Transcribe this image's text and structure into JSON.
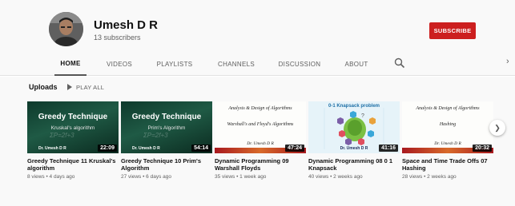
{
  "channel": {
    "name": "Umesh D R",
    "subscribers": "13 subscribers",
    "subscribe_label": "SUBSCRIBE"
  },
  "tabs": [
    {
      "label": "HOME",
      "active": true
    },
    {
      "label": "VIDEOS",
      "active": false
    },
    {
      "label": "PLAYLISTS",
      "active": false
    },
    {
      "label": "CHANNELS",
      "active": false
    },
    {
      "label": "DISCUSSION",
      "active": false
    },
    {
      "label": "ABOUT",
      "active": false
    }
  ],
  "icons": {
    "search": "search-icon",
    "next_tabs": "chevron-right-icon",
    "next_shelf": "chevron-right-icon"
  },
  "uploads": {
    "title": "Uploads",
    "play_all": "PLAY ALL"
  },
  "thumb_text": {
    "greedy_title": "Greedy Technique",
    "greedy_kruskal": "Kruskal's algorithm",
    "greedy_prim": "Prim's Algorithm",
    "greedy_author": "Dr. Umesh D R",
    "ada_heading": "Analysis & Design of Algorithms",
    "warshall_floyd": "Warshall's and Floyd's Algorithms",
    "hashing": "Hashing",
    "script_author": "Dr. Umesh D R",
    "knapsack_title": "0-1 Knapsack problem",
    "knapsack_author": "Dr. Umesh D R"
  },
  "videos": [
    {
      "title": "Greedy Technique 11 Kruskal's algorithm",
      "meta": "8 views • 4 days ago",
      "duration": "22:09"
    },
    {
      "title": "Greedy Technique 10 Prim's Algorithm",
      "meta": "27 views • 6 days ago",
      "duration": "54:14"
    },
    {
      "title": "Dynamic Programming 09 Warshall Floyds",
      "meta": "35 views • 1 week ago",
      "duration": "47:24"
    },
    {
      "title": "Dynamic Programming 08 0 1 Knapsack",
      "meta": "40 views • 2 weeks ago",
      "duration": "41:16"
    },
    {
      "title": "Space and Time Trade Offs 07 Hashing",
      "meta": "28 views • 2 weeks ago",
      "duration": "20:32"
    }
  ],
  "colors": {
    "subscribe": "#cc1f1f",
    "background": "#f9f9f9"
  }
}
